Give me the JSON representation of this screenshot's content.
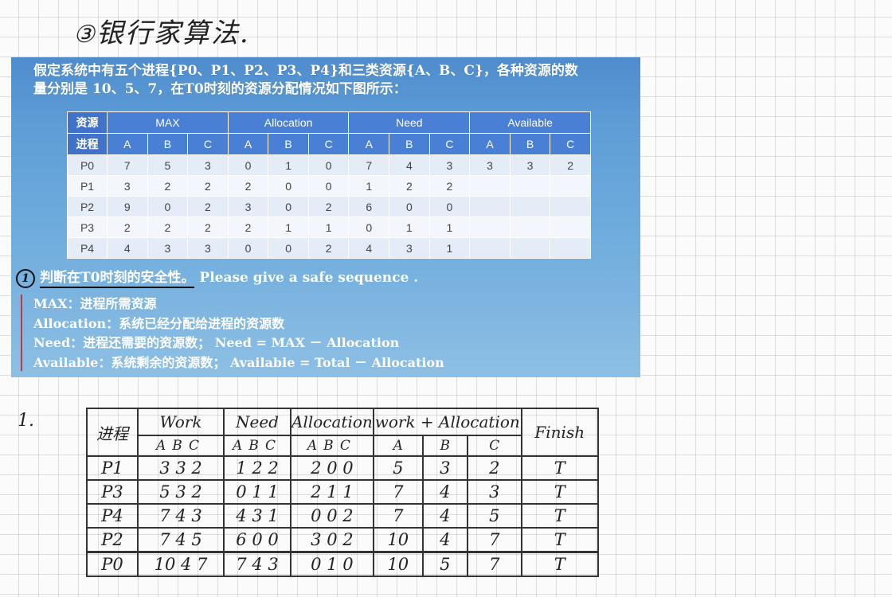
{
  "heading": {
    "number": "③",
    "title": "银行家算法."
  },
  "slide": {
    "intro_lines": [
      "假定系统中有五个进程{P0、P1、P2、P3、P4}和三类资源{A、B、C}，各种资源的数",
      "量分别是 10、5、7，在T0时刻的资源分配情况如下图所示："
    ],
    "watermark": "",
    "table": {
      "corner_top": "资源",
      "corner_bottom": "进程",
      "groups": [
        "MAX",
        "Allocation",
        "Need",
        "Available"
      ],
      "subcols": [
        "A",
        "B",
        "C"
      ],
      "rows": [
        {
          "p": "P0",
          "max": [
            "7",
            "5",
            "3"
          ],
          "alloc": [
            "0",
            "1",
            "0"
          ],
          "need": [
            "7",
            "4",
            "3"
          ],
          "avail": [
            "3",
            "3",
            "2"
          ]
        },
        {
          "p": "P1",
          "max": [
            "3",
            "2",
            "2"
          ],
          "alloc": [
            "2",
            "0",
            "0"
          ],
          "need": [
            "1",
            "2",
            "2"
          ],
          "avail": [
            "",
            "",
            ""
          ]
        },
        {
          "p": "P2",
          "max": [
            "9",
            "0",
            "2"
          ],
          "alloc": [
            "3",
            "0",
            "2"
          ],
          "need": [
            "6",
            "0",
            "0"
          ],
          "avail": [
            "",
            "",
            ""
          ]
        },
        {
          "p": "P3",
          "max": [
            "2",
            "2",
            "2"
          ],
          "alloc": [
            "2",
            "1",
            "1"
          ],
          "need": [
            "0",
            "1",
            "1"
          ],
          "avail": [
            "",
            "",
            ""
          ]
        },
        {
          "p": "P4",
          "max": [
            "4",
            "3",
            "3"
          ],
          "alloc": [
            "0",
            "0",
            "2"
          ],
          "need": [
            "4",
            "3",
            "1"
          ],
          "avail": [
            "",
            "",
            ""
          ]
        }
      ]
    },
    "question": {
      "mark": "1",
      "text": "判断在T0时刻的安全性。",
      "suffix": "Please give a safe sequence ."
    },
    "definitions": [
      "MAX：进程所需资源",
      "Allocation：系统已经分配给进程的资源数",
      "Need：进程还需要的资源数； Need = MAX － Allocation",
      "Available：系统剩余的资源数； Available = Total － Allocation"
    ]
  },
  "answer": {
    "part": "1.",
    "headers": {
      "process": "进程",
      "work": "Work",
      "need": "Need",
      "allocation": "Allocation",
      "work_alloc": "work + Allocation",
      "finish": "Finish"
    },
    "sub": [
      "A",
      "B",
      "C"
    ],
    "rows": [
      {
        "p": "P1",
        "work": "3 3 2",
        "need": "1 2 2",
        "alloc": "2 0 0",
        "wa": [
          "5",
          "3",
          "2"
        ],
        "finish": "T"
      },
      {
        "p": "P3",
        "work": "5 3 2",
        "need": "0 1 1",
        "alloc": "2 1 1",
        "wa": [
          "7",
          "4",
          "3"
        ],
        "finish": "T"
      },
      {
        "p": "P4",
        "work": "7 4 3",
        "need": "4 3 1",
        "alloc": "0 0 2",
        "wa": [
          "7",
          "4",
          "5"
        ],
        "finish": "T"
      },
      {
        "p": "P2",
        "work": "7 4 5",
        "need": "6 0 0",
        "alloc": "3 0 2",
        "wa": [
          "10",
          "4",
          "7"
        ],
        "finish": "T"
      },
      {
        "p": "P0",
        "work": "10 4 7",
        "need": "7 4 3",
        "alloc": "0 1 0",
        "wa": [
          "10",
          "5",
          "7"
        ],
        "finish": "T"
      }
    ]
  }
}
